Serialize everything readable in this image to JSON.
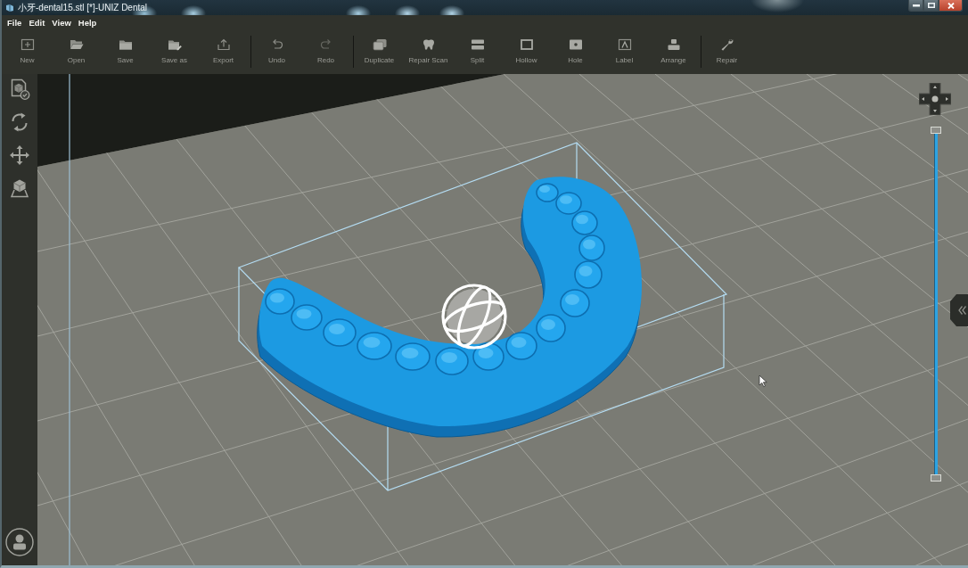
{
  "window": {
    "title": "小牙-dental15.stl [*]-UNIZ Dental"
  },
  "menu": [
    "File",
    "Edit",
    "View",
    "Help"
  ],
  "toolbar": [
    [
      {
        "kind": "new",
        "label": "New"
      },
      {
        "kind": "open",
        "label": "Open"
      },
      {
        "kind": "save",
        "label": "Save"
      },
      {
        "kind": "saveas",
        "label": "Save as"
      },
      {
        "kind": "export",
        "label": "Export"
      }
    ],
    [
      {
        "kind": "undo",
        "label": "Undo"
      },
      {
        "kind": "redo",
        "label": "Redo"
      }
    ],
    [
      {
        "kind": "duplicate",
        "label": "Duplicate"
      },
      {
        "kind": "repairscan",
        "label": "Repair Scan"
      },
      {
        "kind": "split",
        "label": "Split"
      },
      {
        "kind": "hollow",
        "label": "Hollow"
      },
      {
        "kind": "hole",
        "label": "Hole"
      },
      {
        "kind": "label",
        "label": "Label"
      },
      {
        "kind": "arrange",
        "label": "Arrange"
      }
    ],
    [
      {
        "kind": "repair",
        "label": "Repair"
      }
    ]
  ],
  "layer_slider": {
    "level": 1
  }
}
